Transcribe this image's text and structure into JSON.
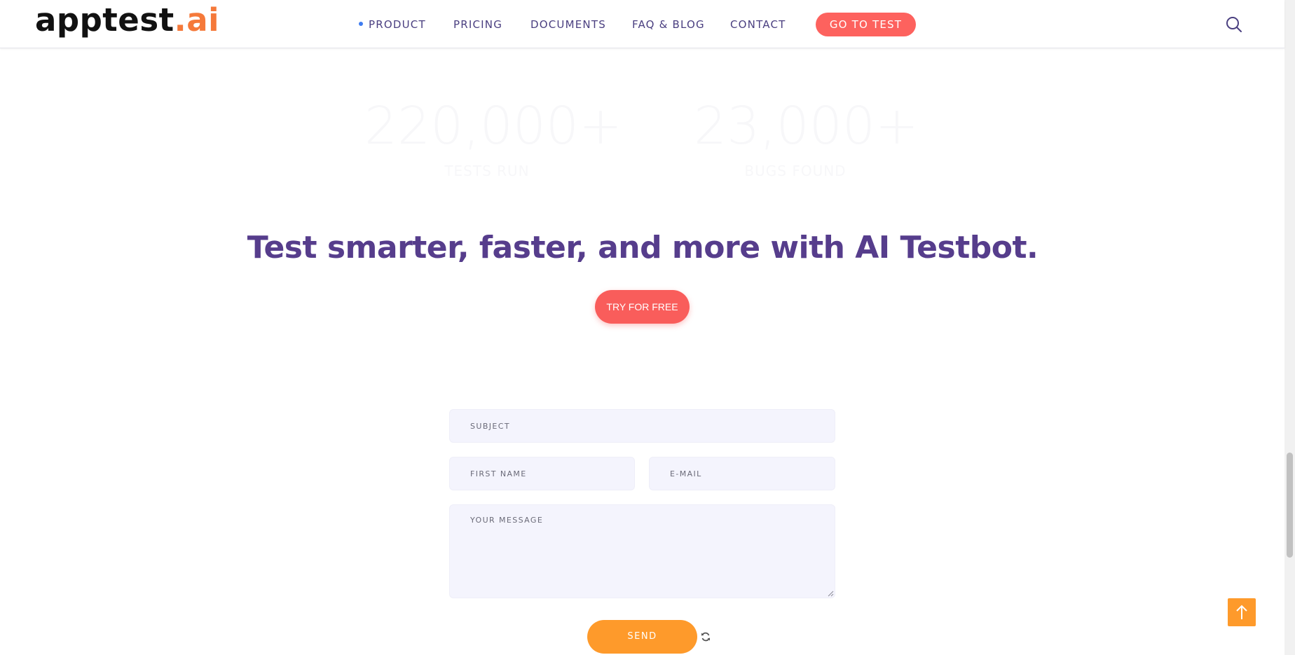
{
  "header": {
    "logo_main": "apptest",
    "logo_accent": ".ai",
    "nav": [
      {
        "label": "PRODUCT"
      },
      {
        "label": "PRICING"
      },
      {
        "label": "DOCUMENTS"
      },
      {
        "label": "FAQ & BLOG"
      },
      {
        "label": "CONTACT"
      }
    ],
    "cta_label": "GO TO TEST"
  },
  "stats": [
    {
      "value": "220,000+",
      "label": "TESTS RUN"
    },
    {
      "value": "23,000+",
      "label": "BUGS FOUND"
    }
  ],
  "hero": {
    "headline": "Test smarter, faster, and more with AI Testbot.",
    "cta_label": "TRY FOR FREE"
  },
  "form": {
    "subject_placeholder": "SUBJECT",
    "first_name_placeholder": "FIRST NAME",
    "email_placeholder": "E-MAIL",
    "message_placeholder": "YOUR MESSAGE",
    "send_label": "SEND"
  },
  "colors": {
    "brand_accent": "#f5793a",
    "nav_text": "#4a3f80",
    "headline": "#563d8c",
    "coral_button": "#fd625e",
    "orange_button": "#fe9a2b",
    "field_bg": "#f4f4fd"
  },
  "icons": {
    "search": "search-icon",
    "refresh": "refresh-icon",
    "back_to_top": "arrow-up-icon"
  }
}
